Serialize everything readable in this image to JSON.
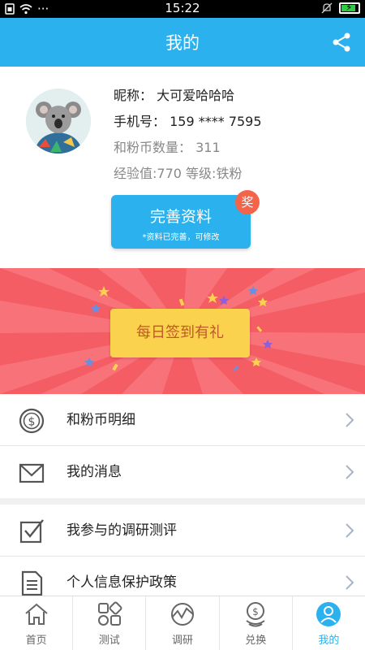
{
  "status_bar": {
    "time": "15:22",
    "left_indicators": "···"
  },
  "header": {
    "title": "我的"
  },
  "profile": {
    "nickname_label": "昵称：",
    "nickname": "大可爱哈哈哈",
    "phone_label": "手机号：",
    "phone": "159 **** 7595",
    "coins_label": "和粉币数量：",
    "coins": "311",
    "exp_label": "经验值:",
    "exp": "770",
    "level_label": "等级:",
    "level": "铁粉",
    "complete_button": "完善资料",
    "complete_sub": "*资料已完善，可修改",
    "reward_badge": "奖"
  },
  "banner": {
    "checkin_button": "每日签到有礼"
  },
  "menu_group1": [
    {
      "label": "和粉币明细",
      "icon": "coin-icon"
    },
    {
      "label": "我的消息",
      "icon": "envelope-icon"
    }
  ],
  "menu_group2": [
    {
      "label": "我参与的调研测评",
      "icon": "checkbox-icon"
    },
    {
      "label": "个人信息保护政策",
      "icon": "document-icon"
    }
  ],
  "tabs": [
    {
      "label": "首页",
      "icon": "home-icon"
    },
    {
      "label": "测试",
      "icon": "grid-shapes-icon"
    },
    {
      "label": "调研",
      "icon": "chart-icon"
    },
    {
      "label": "兑换",
      "icon": "exchange-coins-icon"
    },
    {
      "label": "我的",
      "icon": "user-icon",
      "active": true
    }
  ],
  "colors": {
    "accent": "#2bb1ee",
    "banner": "#f45d63",
    "checkin": "#fbd24e",
    "badge": "#f3644a"
  }
}
